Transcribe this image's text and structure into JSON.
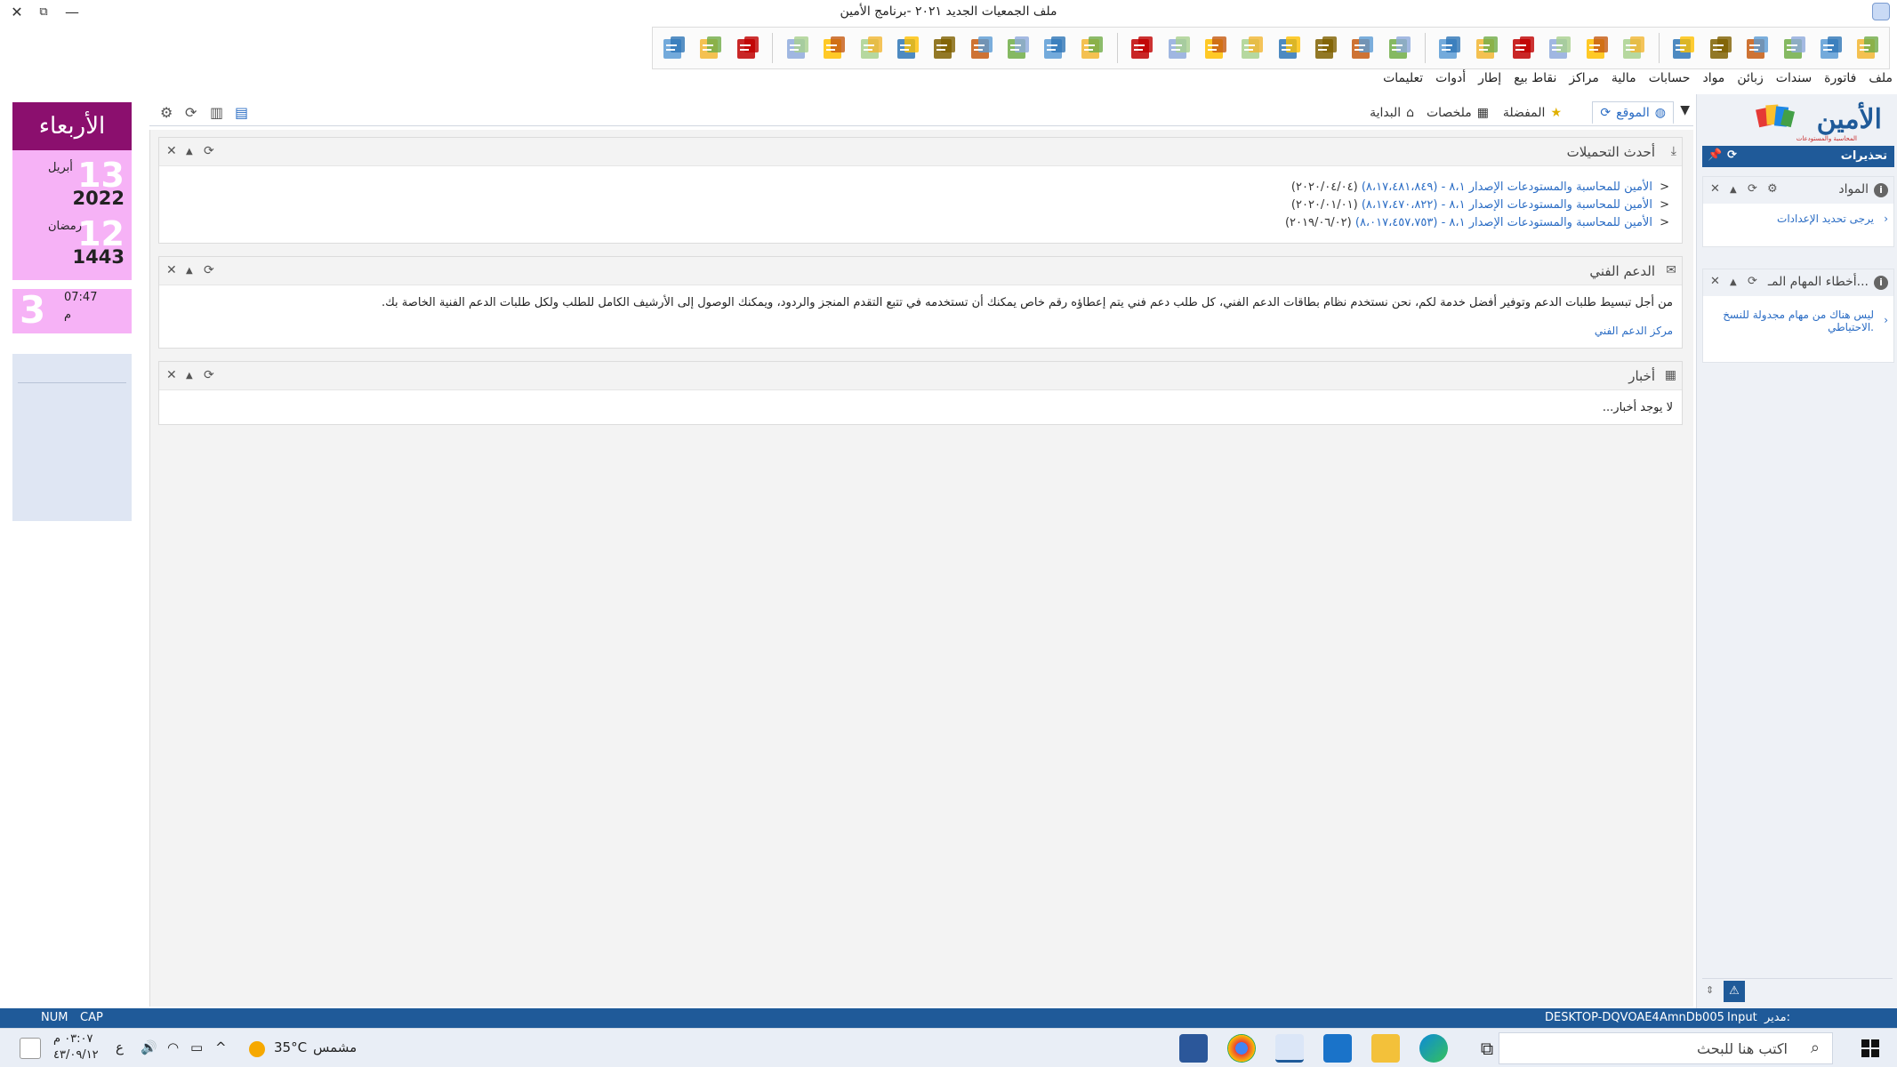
{
  "window": {
    "title": "ملف الجمعيات الجديد ٢٠٢١ -برنامج الأمين",
    "close_label": "✕",
    "restore_label": "⧉",
    "minimize_label": "—"
  },
  "menu": [
    "ملف",
    "فاتورة",
    "سندات",
    "زبائن",
    "مواد",
    "حسابات",
    "مالية",
    "مراكز",
    "نقاط بيع",
    "إطار",
    "أدوات",
    "تعليمات"
  ],
  "toolbar_icons": [
    "folder-open-icon",
    "document-edit-icon",
    "palette-icon",
    "certificate-icon",
    "document-check-icon",
    "image-gallery-icon",
    "table-view-icon",
    "list-view-icon",
    "chart-view-icon",
    "sign-icon",
    "folder-chart-icon",
    "book-icon",
    "scale-icon",
    "tag-icon",
    "green-book-icon",
    "chart-printer-icon",
    "report-icon",
    "marker-icon",
    "edit-document-icon",
    "coin-icon",
    "barcode-icon",
    "export-icon",
    "import-icon",
    "out-arrow-icon",
    "in-arrow-icon",
    "people-icon",
    "group-icon",
    "pencil-icon",
    "marker-file-icon",
    "refresh-icon",
    "calculator-icon",
    "database-icon"
  ],
  "brand": {
    "accent": "#1f5a99",
    "date_card": "#f6b2f6",
    "day_band": "#8b0f6e",
    "link": "#2a6cc4"
  },
  "right_panel": {
    "logo_text": "الأمين",
    "logo_sub": "المحاسبة والمستودعات",
    "alerts_title": "تحذيرات",
    "cards": [
      {
        "title": "المواد",
        "message": "يرجى تحديد الإعدادات"
      },
      {
        "title": "أخطاء المهام المـ...",
        "message": "ليس هناك من مهام مجدولة للنسخ الاحتياطي."
      }
    ]
  },
  "date_widget": {
    "day_name": "الأربعاء",
    "greg_day": "13",
    "greg_month": "أبريل",
    "greg_year": "2022",
    "hijri_day": "12",
    "hijri_month": "رمضان",
    "hijri_year": "1443",
    "time": "07:47",
    "period": "م",
    "hour_big": "3"
  },
  "tabs": {
    "site": "الموقع",
    "favorites": "المفضلة",
    "summaries": "ملخصات",
    "home": "البداية"
  },
  "panels": {
    "downloads": {
      "title": "أحدث التحميلات",
      "items": [
        {
          "text": "الأمين للمحاسبة والمستودعات الإصدار ٨،١ - (٨،١٧،٤٨١،٨٤٩)",
          "date": "(٢٠٢٠/٠٤/٠٤)"
        },
        {
          "text": "الأمين للمحاسبة والمستودعات الإصدار ٨،١ - (٨،١٧،٤٧٠،٨٢٢)",
          "date": "(٢٠٢٠/٠١/٠١)"
        },
        {
          "text": "الأمين للمحاسبة والمستودعات الإصدار ٨،١ - (٨،٠١٧،٤٥٧،٧٥٣)",
          "date": "(٢٠١٩/٠٦/٠٢)"
        }
      ]
    },
    "support": {
      "title": "الدعم الفني",
      "body": "من أجل تبسيط طلبات الدعم وتوفير أفضل خدمة لكم، نحن نستخدم نظام بطاقات الدعم الفني، كل طلب دعم فني يتم إعطاؤه رقم خاص يمكنك أن تستخدمه في تتبع التقدم المنجز والردود، ويمكنك الوصول إلى الأرشيف الكامل للطلب ولكل طلبات الدعم الفنية الخاصة بك.",
      "link": "مركز الدعم الفني"
    },
    "news": {
      "title": "أخبار",
      "body": "لا يوجد أخبار..."
    }
  },
  "statusbar": {
    "num": "NUM",
    "cap": "CAP",
    "machine": "DESKTOP-DQVOAE4",
    "db": "AmnDb005",
    "mode": "Input",
    "user": "مدير:"
  },
  "taskbar": {
    "search_placeholder": "اكتب هنا للبحث",
    "weather_temp": "35°C",
    "weather_desc": "مشمس",
    "lang": "ع",
    "clock_time": "٠٣:٠٧ م",
    "clock_date": "٤٣/٠٩/١٢"
  }
}
